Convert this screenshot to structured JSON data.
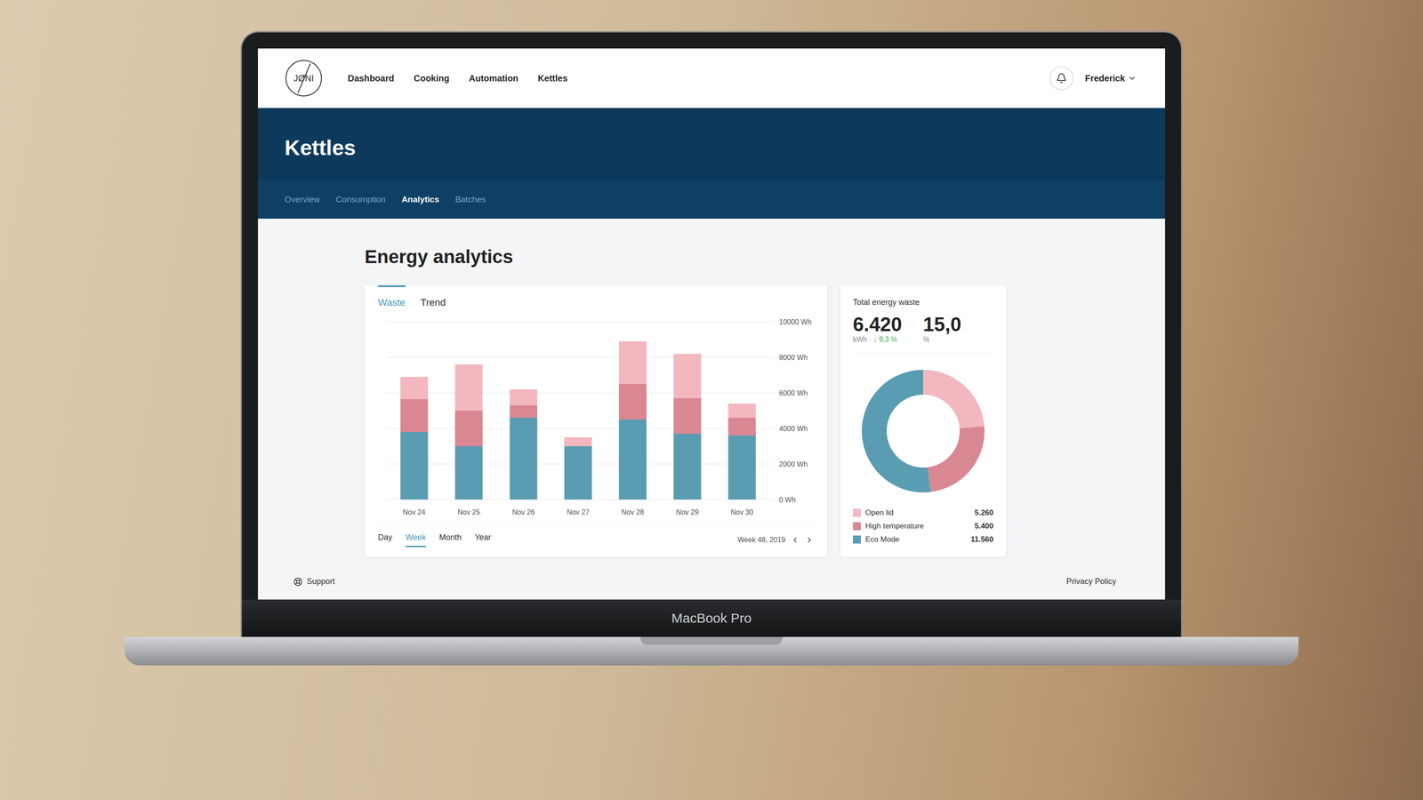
{
  "device": {
    "label": "MacBook Pro"
  },
  "header": {
    "logo": "JØNI",
    "nav": [
      {
        "label": "Dashboard",
        "selected": false
      },
      {
        "label": "Cooking",
        "selected": false
      },
      {
        "label": "Automation",
        "selected": false
      },
      {
        "label": "Kettles",
        "selected": false
      }
    ],
    "user": "Frederick"
  },
  "section": {
    "title": "Kettles",
    "tabs": [
      {
        "label": "Overview",
        "selected": false
      },
      {
        "label": "Consumption",
        "selected": false
      },
      {
        "label": "Analytics",
        "selected": true
      },
      {
        "label": "Batches",
        "selected": false
      }
    ]
  },
  "analytics": {
    "title": "Energy analytics",
    "chart_tabs": [
      {
        "label": "Waste",
        "selected": true
      },
      {
        "label": "Trend",
        "selected": false
      }
    ],
    "chart": {
      "y_max": 10000,
      "y_ticks": [
        "10000 Wh",
        "8000 Wh",
        "6000 Wh",
        "4000 Wh",
        "2000 Wh",
        "0 Wh"
      ],
      "x_labels": [
        "Nov 24",
        "Nov 25",
        "Nov 26",
        "Nov 27",
        "Nov 28",
        "Nov 29",
        "Nov 30"
      ],
      "series": [
        {
          "color": "#5a9cb2",
          "values": [
            3800,
            3000,
            4600,
            3000,
            4500,
            3700,
            3600
          ]
        },
        {
          "color": "#d98793",
          "values": [
            1850,
            2000,
            700,
            0,
            2000,
            2000,
            1000
          ]
        },
        {
          "color": "#f3b7c0",
          "values": [
            1250,
            2600,
            900,
            500,
            2400,
            2500,
            800
          ]
        }
      ]
    },
    "ranges": [
      {
        "label": "Day",
        "selected": false
      },
      {
        "label": "Week",
        "selected": true
      },
      {
        "label": "Month",
        "selected": false
      },
      {
        "label": "Year",
        "selected": false
      }
    ],
    "period": "Week 48, 2019"
  },
  "summary": {
    "title": "Total energy waste",
    "total": "6.420",
    "unit": "kWh",
    "separator": "·",
    "change": "↓ 9,3 %",
    "share": "15,0",
    "share_unit": "%",
    "legend": [
      {
        "label": "Open lid",
        "value": "5.260",
        "amount": 5260,
        "color": "#f3b7c0"
      },
      {
        "label": "High temperature",
        "value": "5.400",
        "amount": 5400,
        "color": "#d98793"
      },
      {
        "label": "Eco Mode",
        "value": "11.560",
        "amount": 11560,
        "color": "#5a9cb2"
      }
    ]
  },
  "footer": {
    "support": "Support",
    "privacy": "Privacy Policy"
  }
}
